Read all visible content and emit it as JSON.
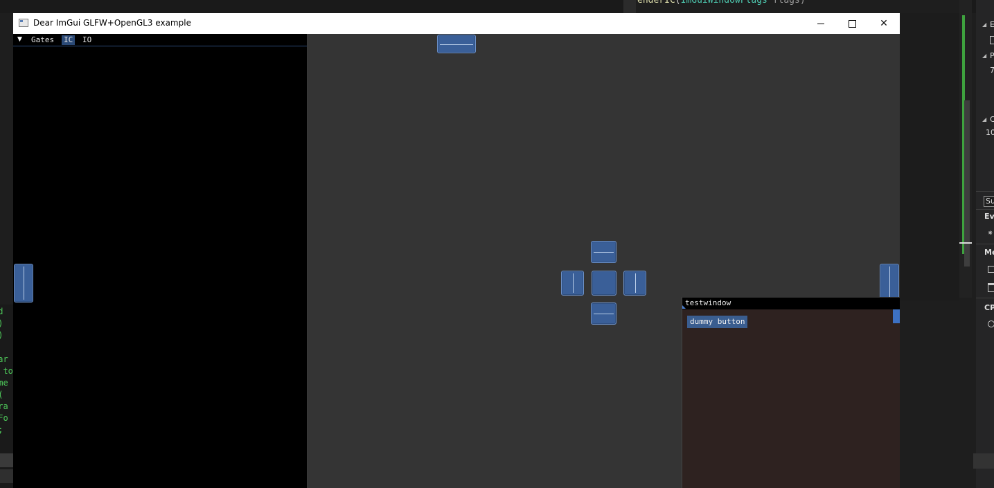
{
  "ide": {
    "code_top": {
      "func": "enderIC",
      "type": "ImGuiWindowFlags",
      "param": " flags)"
    },
    "left_code_lines": [
      "nd",
      "()",
      "()",
      "",
      "ear",
      "t to",
      "ame",
      "r(",
      "dra",
      "rFo",
      ");"
    ],
    "right_panel": {
      "items": [
        "E",
        "P",
        "7",
        "C",
        "10",
        "Su",
        "Eve",
        "Me",
        "CP"
      ]
    },
    "accent_colors": {
      "green": "#3ea23e",
      "code_fn": "#dcdcaa",
      "code_type": "#4ec9b0"
    }
  },
  "app_window": {
    "title": "Dear ImGui GLFW+OpenGL3 example",
    "controls": {
      "minimize": "minimize",
      "maximize": "maximize",
      "close": "✕"
    },
    "left_panel": {
      "collapse_glyph": "▼",
      "tabs": [
        {
          "label": "Gates",
          "active": false
        },
        {
          "label": "IC",
          "active": true
        },
        {
          "label": "IO",
          "active": false
        }
      ]
    },
    "testwindow": {
      "title": "testwindow",
      "button_label": "dummy button"
    },
    "colors": {
      "canvas": "#343434",
      "dock_button": "#3a5f98",
      "testwindow_bg": "#2e2220"
    }
  }
}
